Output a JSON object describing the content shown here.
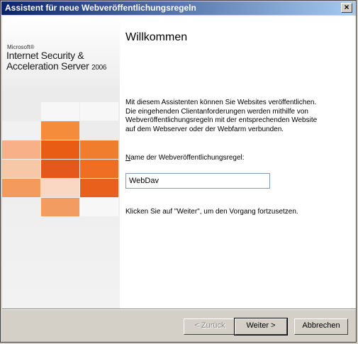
{
  "window": {
    "title": "Assistent für neue Webveröffentlichungsregeln",
    "close_glyph": "×"
  },
  "brand": {
    "microsoft": "Microsoft®",
    "line1": "Internet Security &",
    "line2_name": "Acceleration Server",
    "year": "2006"
  },
  "tiles": [
    {
      "color": "#ebebeb",
      "opacity": 1
    },
    {
      "color": "#f7f7f7",
      "opacity": 1
    },
    {
      "color": "#f7f7f7",
      "opacity": 1
    },
    {
      "color": "#f1f1f1",
      "opacity": 1
    },
    {
      "color": "#f48c3c",
      "opacity": 1
    },
    {
      "color": "#f8b088",
      "opacity": 1
    },
    {
      "color": "#e85c14",
      "opacity": 1
    },
    {
      "color": "#f07c2e",
      "opacity": 1
    },
    {
      "color": "#f7c8a8",
      "opacity": 1
    },
    {
      "color": "#e4581e",
      "opacity": 1
    },
    {
      "color": "#ee6e24",
      "opacity": 1
    },
    {
      "color": "#f39a5c",
      "opacity": 1
    },
    {
      "color": "#fad7c2",
      "opacity": 1
    },
    {
      "color": "#e8601c",
      "opacity": 1
    },
    {
      "color": "#f39c62",
      "opacity": 1
    },
    {
      "color": "#f7f7f7",
      "opacity": 1
    }
  ],
  "main": {
    "heading": "Willkommen",
    "description": "Mit diesem Assistenten können Sie Websites veröffentlichen. Die eingehenden Clientanforderungen werden mithilfe von Webveröffentlichungsregeln mit der entsprechenden Website auf dem Webserver oder der Webfarm verbunden.",
    "name_label_prefix": "N",
    "name_label_rest": "ame der Webveröffentlichungsregel:",
    "name_value": "WebDav",
    "hint": "Klicken Sie auf \"Weiter\", um den Vorgang fortzusetzen."
  },
  "buttons": {
    "back": "< Zurück",
    "next": "Weiter >",
    "cancel": "Abbrechen"
  }
}
